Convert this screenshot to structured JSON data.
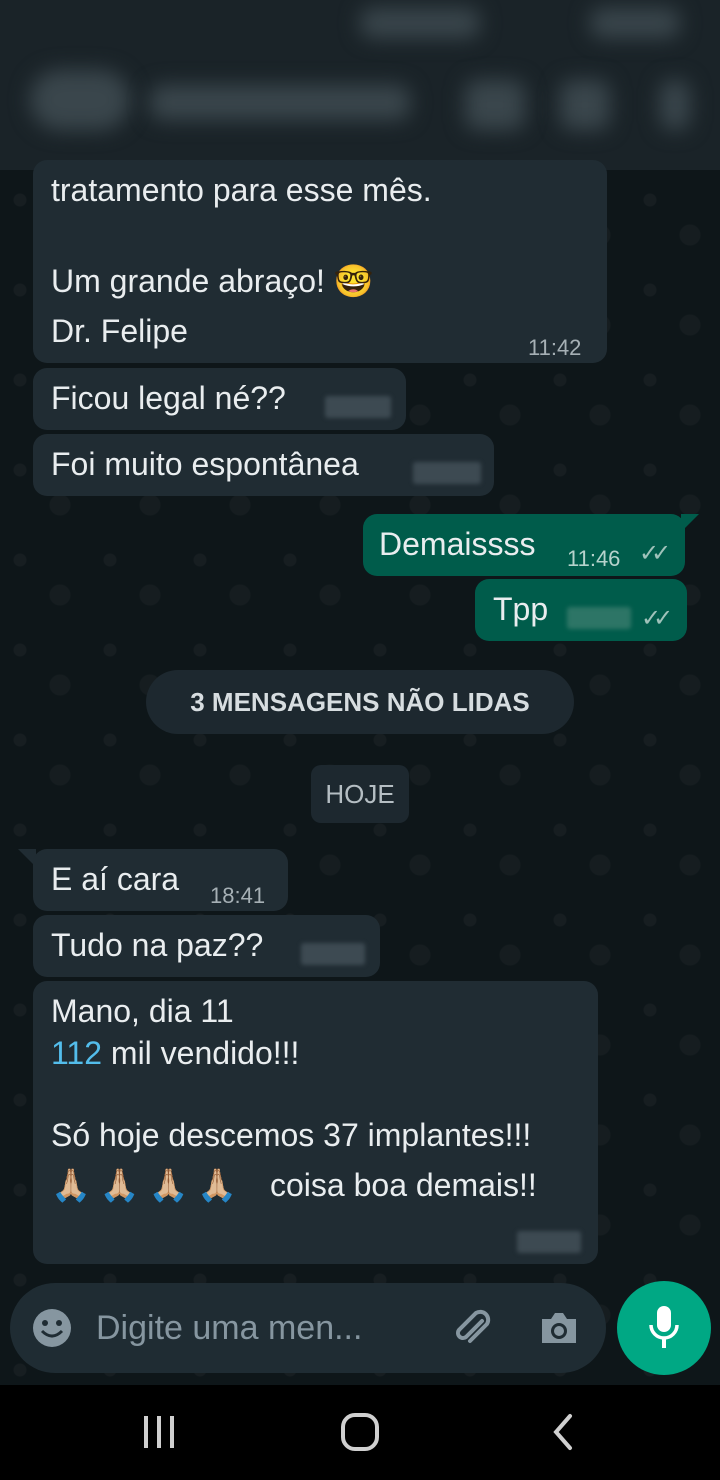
{
  "chat": {
    "messages": [
      {
        "id": "m1",
        "dir": "in",
        "lines": [
          "tratamento para esse mês.",
          "",
          "Um grande abraço! 🤓",
          "Dr. Felipe"
        ],
        "time": "11:42"
      },
      {
        "id": "m2",
        "dir": "in",
        "text": "Ficou legal né??",
        "time": ""
      },
      {
        "id": "m3",
        "dir": "in",
        "text": "Foi muito espontânea",
        "time": ""
      },
      {
        "id": "m4",
        "dir": "out",
        "text": "Demaissss",
        "time": "11:46",
        "status": "read"
      },
      {
        "id": "m5",
        "dir": "out",
        "text": "Tpp",
        "time": "",
        "status": "read"
      },
      {
        "id": "m6",
        "dir": "in",
        "text": "E aí cara",
        "time": "18:41"
      },
      {
        "id": "m7",
        "dir": "in",
        "text": "Tudo na paz??",
        "time": ""
      },
      {
        "id": "m8",
        "dir": "in",
        "line1": "Mano, dia 11",
        "line2_link": "112",
        "line2_rest": " mil vendido!!!",
        "line3": "Só hoje descemos 37 implantes!!!",
        "line4_emoji": "🙏🏼 🙏🏼 🙏🏼 🙏🏼",
        "line4_text": "coisa boa demais!!",
        "time": ""
      }
    ],
    "unread_banner": "3 MENSAGENS NÃO LIDAS",
    "date_chip": "HOJE"
  },
  "composer": {
    "placeholder": "Digite uma men...",
    "icons": {
      "emoji": "emoji-icon",
      "attach": "paperclip-icon",
      "camera": "camera-icon",
      "mic": "microphone-icon"
    }
  },
  "colors": {
    "incoming_bubble": "#202c33",
    "outgoing_bubble": "#005c4b",
    "accent": "#00a884",
    "link": "#53bdeb"
  },
  "navbar": {
    "icons": [
      "recent-apps-icon",
      "home-icon",
      "back-icon"
    ]
  }
}
